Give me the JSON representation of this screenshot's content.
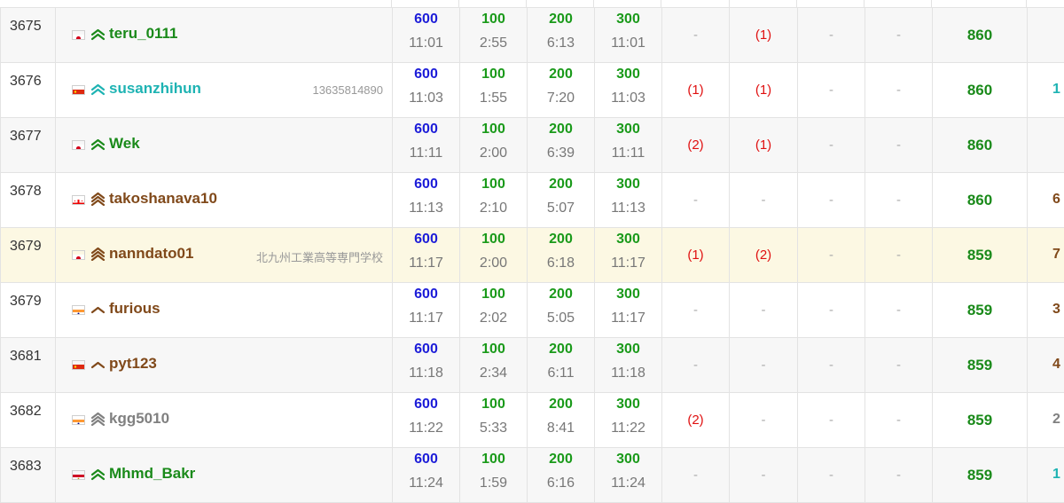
{
  "colors": {
    "score_600": "#1c1cd8",
    "score_other": "#1a9a1a",
    "total": "#1a8a1a",
    "penalty": "#e01010",
    "rank_green": "#1a8a1a",
    "rank_cyan": "#1eb3b3",
    "rank_brown": "#80491a",
    "rank_gray": "#808080",
    "highlight_row": "#fcf8e3"
  },
  "rows": [
    {
      "rank": "3675",
      "flag": "japan",
      "rank_icon": "chevron-double-up-icon",
      "name": "teru_0111",
      "name_color": "#1a8a1a",
      "affiliation": "",
      "scores": [
        "600",
        "100",
        "200",
        "300"
      ],
      "times": [
        "11:01",
        "2:55",
        "6:13",
        "11:01"
      ],
      "penalties": [
        "-",
        "(1)",
        "-",
        "-"
      ],
      "total": "860",
      "extra": "",
      "extra_color": "#1eb3b3"
    },
    {
      "rank": "3676",
      "flag": "china",
      "rank_icon": "chevron-double-up-icon",
      "name": "susanzhihun",
      "name_color": "#1eb3b3",
      "affiliation": "13635814890",
      "scores": [
        "600",
        "100",
        "200",
        "300"
      ],
      "times": [
        "11:03",
        "1:55",
        "7:20",
        "11:03"
      ],
      "penalties": [
        "(1)",
        "(1)",
        "-",
        "-"
      ],
      "total": "860",
      "extra": "1",
      "extra_color": "#1eb3b3"
    },
    {
      "rank": "3677",
      "flag": "japan",
      "rank_icon": "chevron-double-up-icon",
      "name": "Wek",
      "name_color": "#1a8a1a",
      "affiliation": "",
      "scores": [
        "600",
        "100",
        "200",
        "300"
      ],
      "times": [
        "11:11",
        "2:00",
        "6:39",
        "11:11"
      ],
      "penalties": [
        "(2)",
        "(1)",
        "-",
        "-"
      ],
      "total": "860",
      "extra": "",
      "extra_color": "#1eb3b3"
    },
    {
      "rank": "3678",
      "flag": "georgia",
      "rank_icon": "chevron-triple-up-icon",
      "name": "takoshanava10",
      "name_color": "#80491a",
      "affiliation": "",
      "scores": [
        "600",
        "100",
        "200",
        "300"
      ],
      "times": [
        "11:13",
        "2:10",
        "5:07",
        "11:13"
      ],
      "penalties": [
        "-",
        "-",
        "-",
        "-"
      ],
      "total": "860",
      "extra": "6",
      "extra_color": "#80491a"
    },
    {
      "rank": "3679",
      "flag": "japan",
      "rank_icon": "chevron-triple-up-icon",
      "name": "nanndato01",
      "name_color": "#80491a",
      "affiliation": "北九州工業高等専門学校",
      "scores": [
        "600",
        "100",
        "200",
        "300"
      ],
      "times": [
        "11:17",
        "2:00",
        "6:18",
        "11:17"
      ],
      "penalties": [
        "(1)",
        "(2)",
        "-",
        "-"
      ],
      "total": "859",
      "extra": "7",
      "extra_color": "#80491a",
      "highlight": true
    },
    {
      "rank": "3679",
      "flag": "india",
      "rank_icon": "chevron-up-icon",
      "name": "furious",
      "name_color": "#80491a",
      "affiliation": "",
      "scores": [
        "600",
        "100",
        "200",
        "300"
      ],
      "times": [
        "11:17",
        "2:02",
        "5:05",
        "11:17"
      ],
      "penalties": [
        "-",
        "-",
        "-",
        "-"
      ],
      "total": "859",
      "extra": "3",
      "extra_color": "#80491a"
    },
    {
      "rank": "3681",
      "flag": "china",
      "rank_icon": "chevron-up-icon",
      "name": "pyt123",
      "name_color": "#80491a",
      "affiliation": "",
      "scores": [
        "600",
        "100",
        "200",
        "300"
      ],
      "times": [
        "11:18",
        "2:34",
        "6:11",
        "11:18"
      ],
      "penalties": [
        "-",
        "-",
        "-",
        "-"
      ],
      "total": "859",
      "extra": "4",
      "extra_color": "#80491a"
    },
    {
      "rank": "3682",
      "flag": "india",
      "rank_icon": "chevron-triple-up-icon",
      "name": "kgg5010",
      "name_color": "#808080",
      "affiliation": "",
      "scores": [
        "600",
        "100",
        "200",
        "300"
      ],
      "times": [
        "11:22",
        "5:33",
        "8:41",
        "11:22"
      ],
      "penalties": [
        "(2)",
        "-",
        "-",
        "-"
      ],
      "total": "859",
      "extra": "2",
      "extra_color": "#808080"
    },
    {
      "rank": "3683",
      "flag": "egypt",
      "rank_icon": "chevron-double-up-icon",
      "name": "Mhmd_Bakr",
      "name_color": "#1a8a1a",
      "affiliation": "",
      "scores": [
        "600",
        "100",
        "200",
        "300"
      ],
      "times": [
        "11:24",
        "1:59",
        "6:16",
        "11:24"
      ],
      "penalties": [
        "-",
        "-",
        "-",
        "-"
      ],
      "total": "859",
      "extra": "1",
      "extra_color": "#1eb3b3"
    }
  ]
}
